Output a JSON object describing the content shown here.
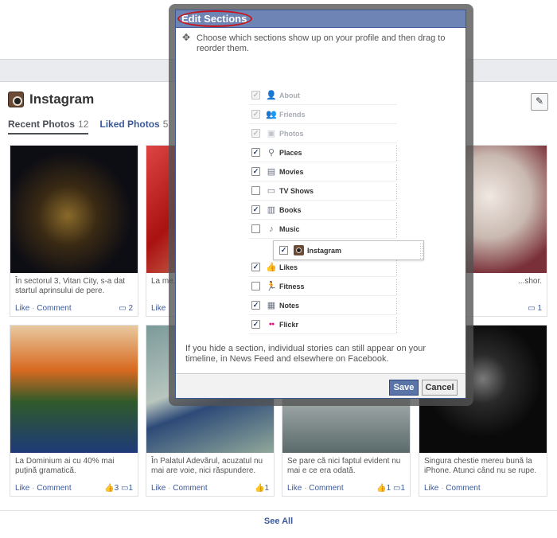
{
  "app": {
    "title": "Instagram"
  },
  "tabs": [
    {
      "label": "Recent Photos",
      "count": "12"
    },
    {
      "label": "Liked Photos",
      "count": "5"
    }
  ],
  "photos": [
    {
      "caption": "În sectorul 3, Vitan City, s-a dat startul aprinsului de pere.",
      "like": "Like",
      "comment": "Comment",
      "comments": "2",
      "likes": ""
    },
    {
      "caption": "La me... pe jos...",
      "like": "Like",
      "comment": "",
      "comments": "",
      "likes": ""
    },
    {
      "caption": "",
      "like": "",
      "comment": "",
      "comments": "",
      "likes": ""
    },
    {
      "caption": "...shor.",
      "like": "",
      "comment": "",
      "comments": "1",
      "likes": ""
    },
    {
      "caption": "La Dominium ai cu 40% mai puțină gramatică.",
      "like": "Like",
      "comment": "Comment",
      "comments": "1",
      "likes": "3"
    },
    {
      "caption": "În Palatul Adevărul, acuzatul nu mai are voie, nici răspundere.",
      "like": "Like",
      "comment": "Comment",
      "comments": "",
      "likes": "1"
    },
    {
      "caption": "Se pare că nici faptul evident nu mai e ce era odată.",
      "like": "Like",
      "comment": "Comment",
      "comments": "1",
      "likes": "1"
    },
    {
      "caption": "Singura chestie mereu bună la iPhone. Atunci când nu se rupe.",
      "like": "Like",
      "comment": "Comment",
      "comments": "",
      "likes": ""
    }
  ],
  "see_all": "See All",
  "dialog": {
    "title": "Edit Sections",
    "intro": "Choose which sections show up on your profile and then drag to reorder them.",
    "sections": [
      {
        "label": "About",
        "checked": true,
        "locked": true,
        "icon": "person-icon",
        "glyph": "👤"
      },
      {
        "label": "Friends",
        "checked": true,
        "locked": true,
        "icon": "friends-icon",
        "glyph": "👥"
      },
      {
        "label": "Photos",
        "checked": true,
        "locked": true,
        "icon": "photos-icon",
        "glyph": "▣"
      },
      {
        "label": "Places",
        "checked": true,
        "locked": false,
        "icon": "map-pin-icon",
        "glyph": "⚲"
      },
      {
        "label": "Movies",
        "checked": true,
        "locked": false,
        "icon": "film-icon",
        "glyph": "▤"
      },
      {
        "label": "TV Shows",
        "checked": false,
        "locked": false,
        "icon": "tv-icon",
        "glyph": "▭"
      },
      {
        "label": "Books",
        "checked": true,
        "locked": false,
        "icon": "book-icon",
        "glyph": "▥"
      },
      {
        "label": "Music",
        "checked": false,
        "locked": false,
        "icon": "music-note-icon",
        "glyph": "♪"
      },
      {
        "label": "",
        "checked": false,
        "locked": false,
        "icon": "",
        "glyph": ""
      },
      {
        "label": "Likes",
        "checked": true,
        "locked": false,
        "icon": "thumbs-up-icon",
        "glyph": "👍"
      },
      {
        "label": "Fitness",
        "checked": false,
        "locked": false,
        "icon": "runner-icon",
        "glyph": "🏃"
      },
      {
        "label": "Notes",
        "checked": true,
        "locked": false,
        "icon": "notes-icon",
        "glyph": "▦"
      },
      {
        "label": "Flickr",
        "checked": true,
        "locked": false,
        "icon": "flickr-icon",
        "glyph": "●●"
      }
    ],
    "dragging": {
      "label": "Instagram",
      "checked": true
    },
    "note": "If you hide a section, individual stories can still appear on your timeline, in News Feed and elsewhere on Facebook.",
    "save_label": "Save",
    "cancel_label": "Cancel"
  }
}
